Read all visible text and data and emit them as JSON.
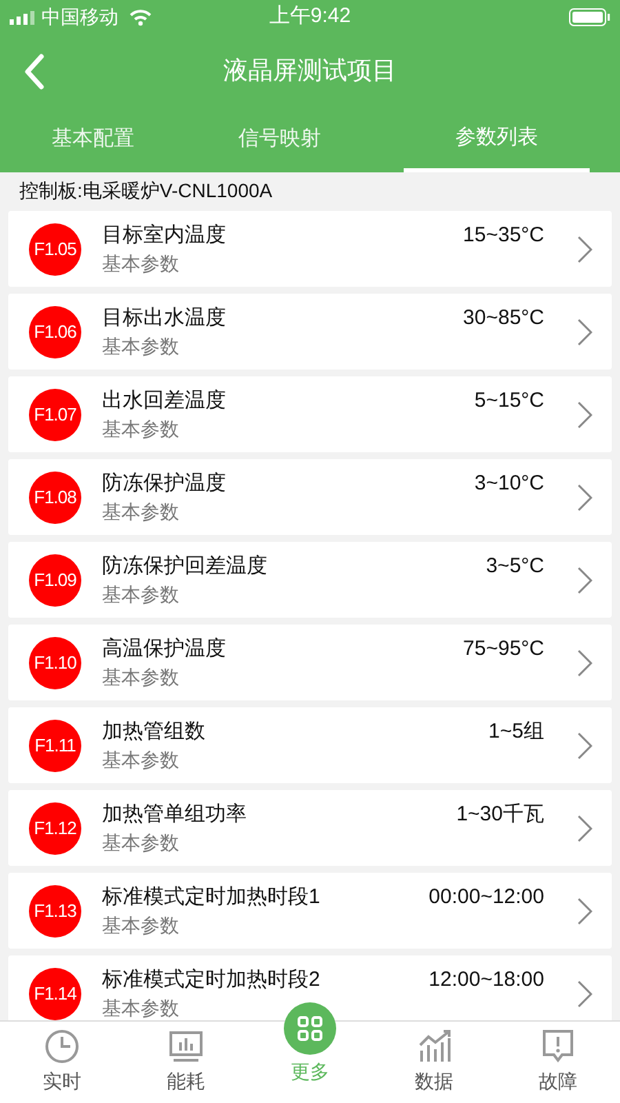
{
  "status_bar": {
    "carrier": "中国移动",
    "time": "上午9:42"
  },
  "header": {
    "title": "液晶屏测试项目"
  },
  "tabs": [
    {
      "label": "基本配置",
      "selected": false
    },
    {
      "label": "信号映射",
      "selected": false
    },
    {
      "label": "参数列表",
      "selected": true
    }
  ],
  "controller": "控制板:电采暖炉V-CNL1000A",
  "params": [
    {
      "code": "F1.05",
      "name": "目标室内温度",
      "category": "基本参数",
      "range": "15~35°C"
    },
    {
      "code": "F1.06",
      "name": "目标出水温度",
      "category": "基本参数",
      "range": "30~85°C"
    },
    {
      "code": "F1.07",
      "name": "出水回差温度",
      "category": "基本参数",
      "range": "5~15°C"
    },
    {
      "code": "F1.08",
      "name": "防冻保护温度",
      "category": "基本参数",
      "range": "3~10°C"
    },
    {
      "code": "F1.09",
      "name": "防冻保护回差温度",
      "category": "基本参数",
      "range": "3~5°C"
    },
    {
      "code": "F1.10",
      "name": "高温保护温度",
      "category": "基本参数",
      "range": "75~95°C"
    },
    {
      "code": "F1.11",
      "name": "加热管组数",
      "category": "基本参数",
      "range": "1~5组"
    },
    {
      "code": "F1.12",
      "name": "加热管单组功率",
      "category": "基本参数",
      "range": "1~30千瓦"
    },
    {
      "code": "F1.13",
      "name": "标准模式定时加热时段1",
      "category": "基本参数",
      "range": "00:00~12:00"
    },
    {
      "code": "F1.14",
      "name": "标准模式定时加热时段2",
      "category": "基本参数",
      "range": "12:00~18:00"
    }
  ],
  "nav": [
    {
      "kind": "clock",
      "label": "实时",
      "selected": false
    },
    {
      "kind": "monitor",
      "label": "能耗",
      "selected": false
    },
    {
      "kind": "grid",
      "label": "更多",
      "selected": true
    },
    {
      "kind": "chart",
      "label": "数据",
      "selected": false
    },
    {
      "kind": "alert",
      "label": "故障",
      "selected": false
    }
  ]
}
